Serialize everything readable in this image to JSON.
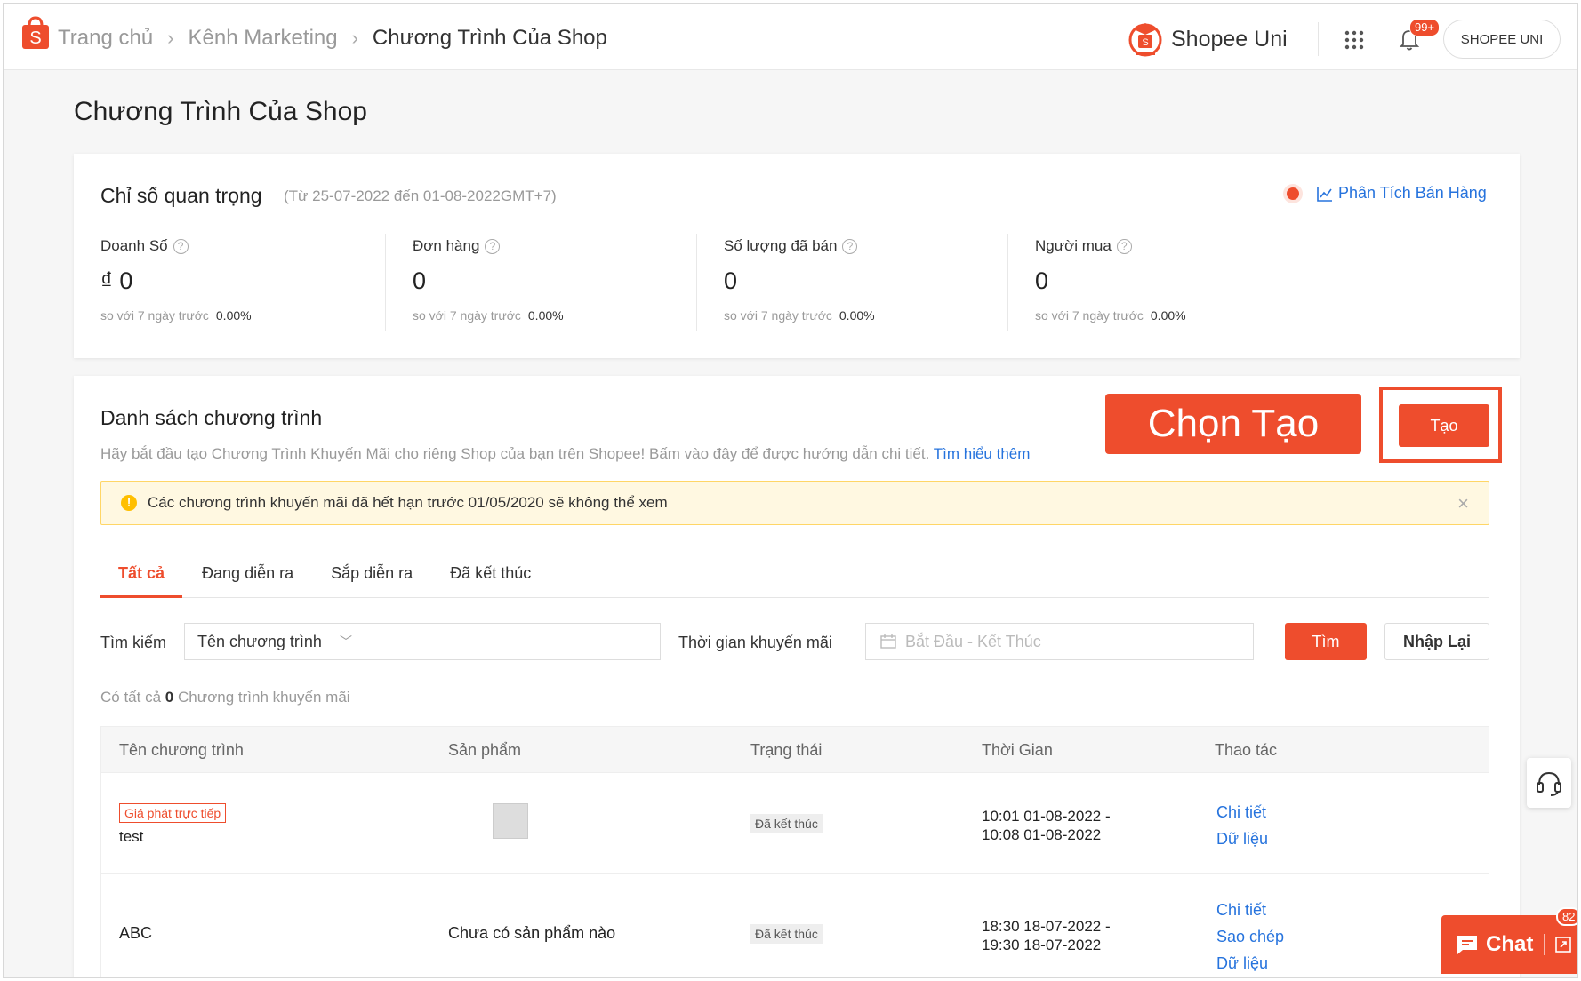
{
  "breadcrumb": {
    "home": "Trang chủ",
    "marketing": "Kênh Marketing",
    "current": "Chương Trình Của Shop"
  },
  "header": {
    "brand_name": "Shopee Uni",
    "notification_count": "99+",
    "user_label": "SHOPEE UNI",
    "accent_color": "#ee4d2d"
  },
  "page": {
    "title": "Chương Trình Của Shop"
  },
  "stats": {
    "title": "Chỉ số quan trọng",
    "range": "(Từ 25-07-2022 đến 01-08-2022GMT+7)",
    "analytics_link": "Phân Tích Bán Hàng",
    "metrics": [
      {
        "label": "Doanh Số",
        "value": "₫ 0",
        "compare_label": "so với 7 ngày trước",
        "compare_value": "0.00%"
      },
      {
        "label": "Đơn hàng",
        "value": "0",
        "compare_label": "so với 7 ngày trước",
        "compare_value": "0.00%"
      },
      {
        "label": "Số lượng đã bán",
        "value": "0",
        "compare_label": "so với 7 ngày trước",
        "compare_value": "0.00%"
      },
      {
        "label": "Người mua",
        "value": "0",
        "compare_label": "so với 7 ngày trước",
        "compare_value": "0.00%"
      }
    ]
  },
  "program_list": {
    "title": "Danh sách chương trình",
    "description": "Hãy bắt đầu tạo Chương Trình Khuyến Mãi cho riêng Shop của bạn trên Shopee! Bấm vào đây để được hướng dẫn chi tiết.",
    "learn_more": "Tìm hiểu thêm",
    "callout": "Chọn Tạo",
    "create_label": "Tạo",
    "warning": "Các chương trình khuyến mãi đã hết hạn trước 01/05/2020 sẽ không thể xem",
    "tabs": [
      "Tất cả",
      "Đang diễn ra",
      "Sắp diễn ra",
      "Đã kết thúc"
    ],
    "filters": {
      "search_label": "Tìm kiếm",
      "search_type": "Tên chương trình",
      "time_label": "Thời gian khuyến mãi",
      "date_placeholder": "Bắt Đầu - Kết Thúc",
      "find_label": "Tìm",
      "reset_label": "Nhập Lại"
    },
    "count_prefix": "Có tất cả",
    "count_value": "0",
    "count_suffix": "Chương trình khuyến mãi",
    "columns": [
      "Tên chương trình",
      "Sản phẩm",
      "Trạng thái",
      "Thời Gian",
      "Thao tác"
    ],
    "rows": [
      {
        "tag": "Giá phát trực tiếp",
        "name": "test",
        "product": "",
        "status": "Đã kết thúc",
        "time_start": "10:01 01-08-2022 -",
        "time_end": "10:08 01-08-2022",
        "actions": [
          "Chi tiết",
          "Dữ liệu"
        ]
      },
      {
        "tag": "",
        "name": "ABC",
        "product": "Chưa có sản phẩm nào",
        "status": "Đã kết thúc",
        "time_start": "18:30 18-07-2022 -",
        "time_end": "19:30 18-07-2022",
        "actions": [
          "Chi tiết",
          "Sao chép",
          "Dữ liệu"
        ]
      }
    ]
  },
  "chat": {
    "label": "Chat",
    "badge": "82"
  }
}
